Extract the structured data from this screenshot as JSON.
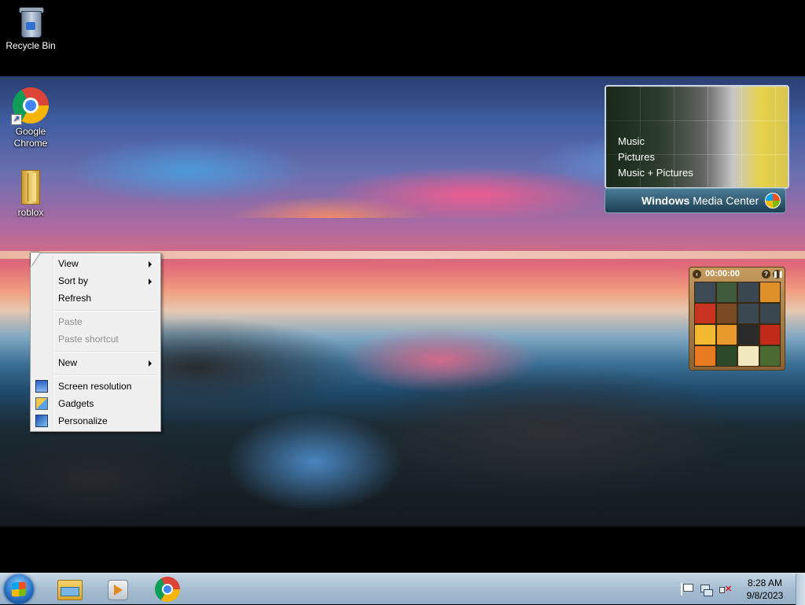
{
  "desktop": {
    "icons": [
      {
        "label": "Recycle Bin",
        "icon": "recycle-bin-icon"
      },
      {
        "label": "Google\nChrome",
        "icon": "chrome-icon"
      },
      {
        "label": "roblox",
        "icon": "folder-icon"
      }
    ]
  },
  "media_center": {
    "menu": [
      "Music",
      "Pictures",
      "Music + Pictures"
    ],
    "brand_bold": "Windows",
    "brand_rest": " Media Center"
  },
  "puzzle": {
    "timer": "00:00:00",
    "help": "?",
    "tile_colors": [
      "#3e4a55",
      "#3f5a3a",
      "#3a4650",
      "#e0902a",
      "#c8321e",
      "#7a4a22",
      "#3b4852",
      "#3a4650",
      "#f2b830",
      "#e89a2a",
      "#2a2a2a",
      "#c22a1a",
      "#e87a22",
      "#2a4a2a",
      "#f2e8c0",
      "#4a6a32"
    ]
  },
  "context_menu": {
    "items": [
      {
        "label": "View",
        "enabled": true,
        "submenu": true
      },
      {
        "label": "Sort by",
        "enabled": true,
        "submenu": true
      },
      {
        "label": "Refresh",
        "enabled": true,
        "submenu": false
      },
      {
        "label": "Paste",
        "enabled": false,
        "submenu": false
      },
      {
        "label": "Paste shortcut",
        "enabled": false,
        "submenu": false
      },
      {
        "label": "New",
        "enabled": true,
        "submenu": true
      },
      {
        "label": "Screen resolution",
        "enabled": true,
        "icon": "monitor-icon"
      },
      {
        "label": "Gadgets",
        "enabled": true,
        "icon": "gadgets-icon"
      },
      {
        "label": "Personalize",
        "enabled": true,
        "icon": "personalize-icon"
      }
    ]
  },
  "taskbar": {
    "pinned": [
      "windows-explorer-icon",
      "media-player-icon",
      "chrome-icon"
    ],
    "tray": [
      "action-center-flag-icon",
      "network-icon",
      "volume-muted-icon"
    ],
    "time": "8:28 AM",
    "date": "9/8/2023"
  }
}
